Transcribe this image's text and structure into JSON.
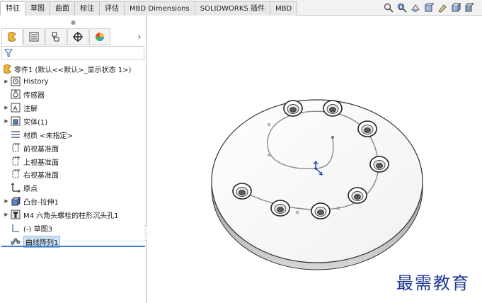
{
  "tabs": [
    {
      "label": "特征",
      "active": true
    },
    {
      "label": "草图",
      "active": false
    },
    {
      "label": "曲面",
      "active": false
    },
    {
      "label": "标注",
      "active": false
    },
    {
      "label": "评估",
      "active": false
    },
    {
      "label": "MBD Dimensions",
      "active": false
    },
    {
      "label": "SOLIDWORKS 插件",
      "active": false
    },
    {
      "label": "MBD",
      "active": false
    }
  ],
  "view_tools": [
    "zoom-to-fit-icon",
    "zoom-area-icon",
    "previous-view-icon",
    "section-view-icon",
    "dynamic-annotation-icon",
    "view-orientation-icon",
    "display-style-icon"
  ],
  "panel_tabs": [
    "feature-manager-icon",
    "property-manager-icon",
    "configuration-manager-icon",
    "dimxpert-manager-icon",
    "display-manager-icon"
  ],
  "tree": {
    "root": "零件1  (默认<<默认>_显示状态 1>)",
    "items": [
      {
        "label": "History",
        "icon": "history-icon",
        "expandable": true
      },
      {
        "label": "传感器",
        "icon": "sensor-icon",
        "expandable": false
      },
      {
        "label": "注解",
        "icon": "annotation-icon",
        "expandable": true
      },
      {
        "label": "实体(1)",
        "icon": "solid-body-icon",
        "expandable": true
      },
      {
        "label": "材质 <未指定>",
        "icon": "material-icon",
        "expandable": false
      },
      {
        "label": "前视基准面",
        "icon": "plane-icon",
        "expandable": false
      },
      {
        "label": "上视基准面",
        "icon": "plane-icon",
        "expandable": false
      },
      {
        "label": "右视基准面",
        "icon": "plane-icon",
        "expandable": false
      },
      {
        "label": "原点",
        "icon": "origin-icon",
        "expandable": false
      },
      {
        "label": "凸台-拉伸1",
        "icon": "boss-extrude-icon",
        "expandable": true
      },
      {
        "label": "M4 六角头螺栓的柱形沉头孔1",
        "icon": "hole-wizard-icon",
        "expandable": true
      },
      {
        "label": "(-) 草图3",
        "icon": "sketch-icon",
        "expandable": false
      },
      {
        "label": "曲线阵列1",
        "icon": "curve-pattern-icon",
        "expandable": false,
        "selected": true
      }
    ]
  },
  "watermark": "最需教育",
  "colors": {
    "accent": "#3a7fd0",
    "watermark": "#1f3a8f",
    "selection": "#cfe3f7"
  }
}
